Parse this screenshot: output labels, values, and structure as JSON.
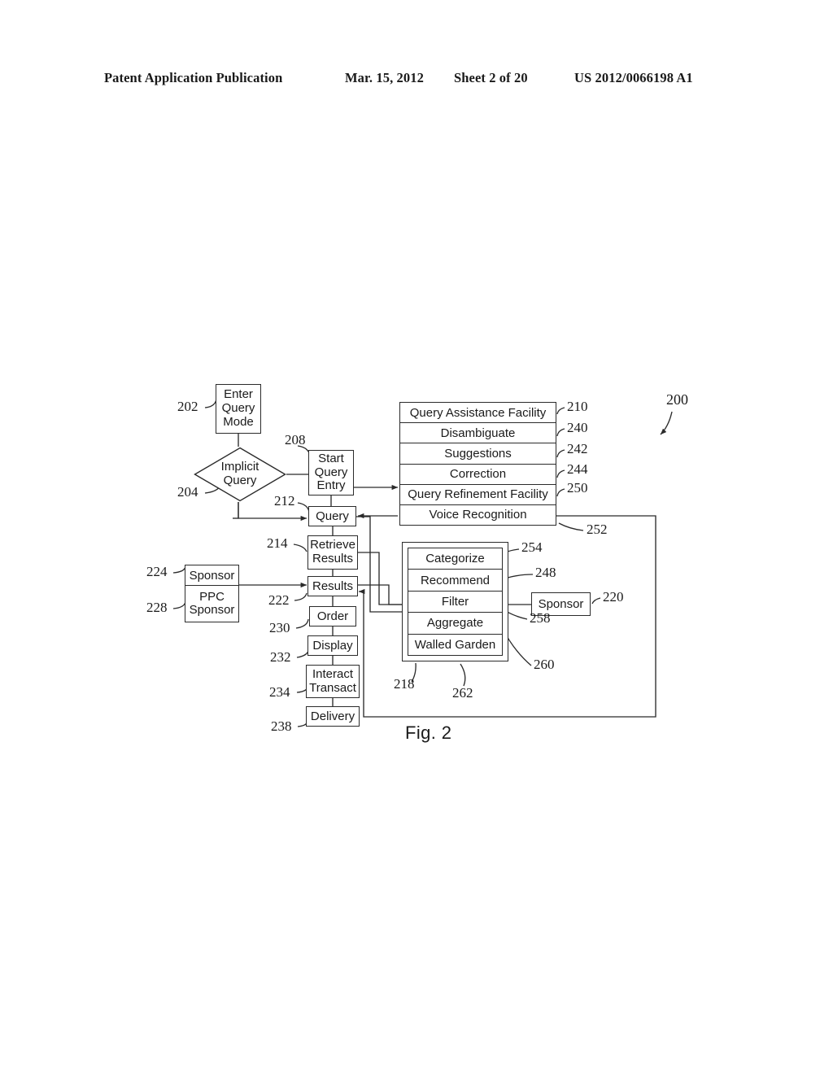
{
  "header": {
    "publication": "Patent Application Publication",
    "date": "Mar. 15, 2012",
    "sheet": "Sheet 2 of 20",
    "patent_number": "US 2012/0066198 A1"
  },
  "figure": {
    "caption": "Fig. 2",
    "system_ref": "200"
  },
  "nodes": {
    "enter_query_mode": {
      "label": "Enter\nQuery\nMode",
      "lines": [
        "Enter",
        "Query",
        "Mode"
      ],
      "ref": "202"
    },
    "implicit_query": {
      "lines": [
        "Implicit",
        "Query"
      ],
      "ref": "204"
    },
    "start_query_entry": {
      "lines": [
        "Start",
        "Query",
        "Entry"
      ],
      "ref": "208"
    },
    "query": {
      "label": "Query",
      "ref": "212"
    },
    "retrieve_results": {
      "lines": [
        "Retrieve",
        "Results"
      ],
      "ref": "214"
    },
    "results": {
      "label": "Results",
      "ref": "222"
    },
    "order": {
      "label": "Order",
      "ref": "230"
    },
    "display": {
      "label": "Display",
      "ref": "232"
    },
    "interact_transact": {
      "lines": [
        "Interact",
        "Transact"
      ],
      "ref": "234"
    },
    "delivery": {
      "label": "Delivery",
      "ref": "238"
    },
    "sponsor_left": {
      "label": "Sponsor",
      "ref": "224"
    },
    "ppc_sponsor": {
      "lines": [
        "PPC",
        "Sponsor"
      ],
      "ref": "228"
    },
    "sponsor_right": {
      "label": "Sponsor",
      "ref": "220"
    }
  },
  "query_assistance_stack": {
    "ref_outer": "210",
    "rows": [
      {
        "label": "Query Assistance Facility",
        "ref": "210"
      },
      {
        "label": "Disambiguate",
        "ref": "240"
      },
      {
        "label": "Suggestions",
        "ref": "242"
      },
      {
        "label": "Correction",
        "ref": "244"
      },
      {
        "label": "Query Refinement Facility",
        "ref": "250"
      },
      {
        "label": "Voice Recognition",
        "ref": "252"
      }
    ]
  },
  "results_processing_stack": {
    "ref_outer": "218",
    "rows": [
      {
        "label": "Categorize",
        "ref": "254"
      },
      {
        "label": "Recommend",
        "ref": "248"
      },
      {
        "label": "Filter",
        "ref": "258"
      },
      {
        "label": "Aggregate",
        "ref": "260"
      },
      {
        "label": "Walled Garden",
        "ref": "262"
      }
    ]
  },
  "colors": {
    "ink": "#1a1a1a",
    "line": "#2b2b2b",
    "background": "#ffffff"
  }
}
